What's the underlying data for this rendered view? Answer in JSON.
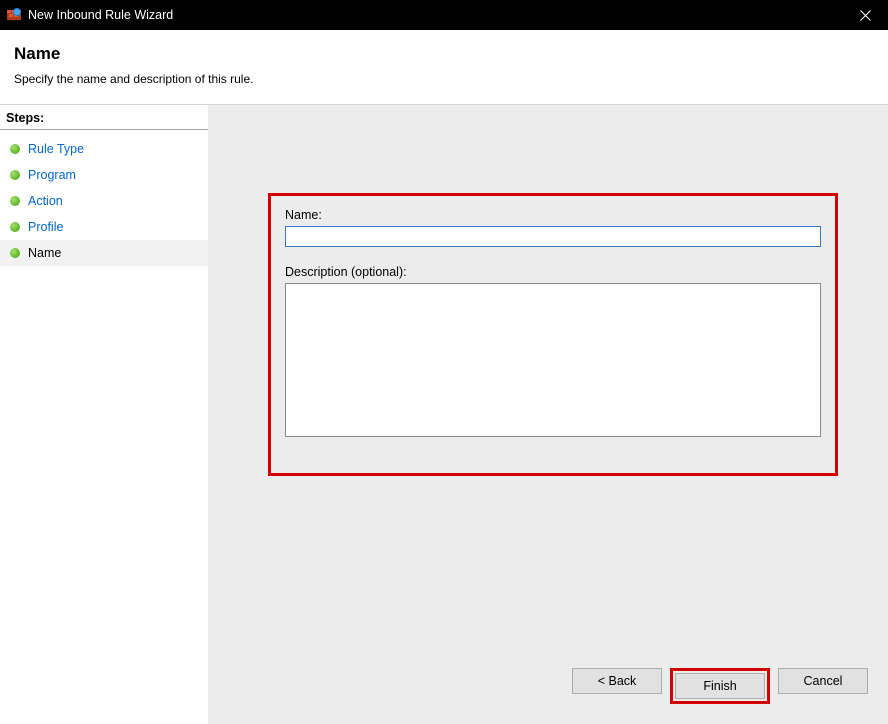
{
  "titlebar": {
    "title": "New Inbound Rule Wizard"
  },
  "header": {
    "title": "Name",
    "subtitle": "Specify the name and description of this rule."
  },
  "sidebar": {
    "title": "Steps:",
    "items": [
      {
        "label": "Rule Type",
        "active": false
      },
      {
        "label": "Program",
        "active": false
      },
      {
        "label": "Action",
        "active": false
      },
      {
        "label": "Profile",
        "active": false
      },
      {
        "label": "Name",
        "active": true
      }
    ]
  },
  "form": {
    "name_label": "Name:",
    "name_value": "",
    "description_label": "Description (optional):",
    "description_value": ""
  },
  "buttons": {
    "back": "< Back",
    "finish": "Finish",
    "cancel": "Cancel"
  }
}
